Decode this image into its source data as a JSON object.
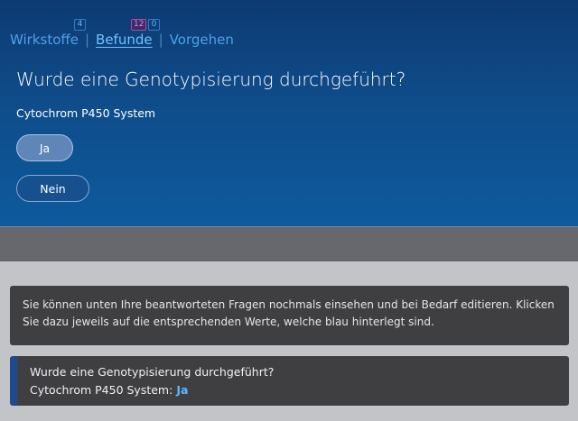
{
  "tabs": [
    {
      "label": "Wirkstoffe",
      "badges": [
        "4"
      ]
    },
    {
      "label": "Befunde",
      "badges": [
        "12",
        "0"
      ]
    },
    {
      "label": "Vorgehen",
      "badges": []
    }
  ],
  "separator": "|",
  "question": {
    "title": "Wurde eine Genotypisierung durchgeführt?",
    "subtitle": "Cytochrom P450 System",
    "options": [
      "Ja",
      "Nein"
    ],
    "selected": "Ja"
  },
  "info": {
    "text": "Sie können unten Ihre beantworteten Fragen nochmals einsehen und bei Bedarf editieren. Klicken Sie dazu jeweils auf die entsprechenden Werte, welche blau hinterlegt sind."
  },
  "answer_summary": {
    "question": "Wurde eine Genotypisierung durchgeführt?",
    "label": "Cytochrom P450 System:",
    "value": "Ja"
  },
  "colors": {
    "accent": "#5db7ff",
    "panel_top": "#0d3a72",
    "badge_pink": "#b54b9a"
  }
}
